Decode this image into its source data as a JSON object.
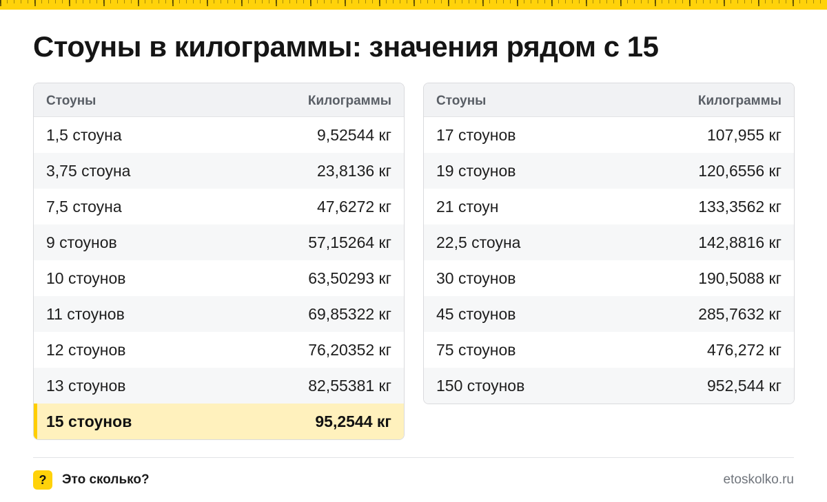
{
  "title": "Стоуны в килограммы: значения рядом с 15",
  "colors": {
    "accent": "#ffd20a",
    "highlight_row": "#fff1bd",
    "header_bg": "#f1f2f4"
  },
  "tables": [
    {
      "headers": [
        "Стоуны",
        "Килограммы"
      ],
      "rows": [
        [
          "1,5 стоуна",
          "9,52544 кг"
        ],
        [
          "3,75 стоуна",
          "23,8136 кг"
        ],
        [
          "7,5 стоуна",
          "47,6272 кг"
        ],
        [
          "9 стоунов",
          "57,15264 кг"
        ],
        [
          "10 стоунов",
          "63,50293 кг"
        ],
        [
          "11 стоунов",
          "69,85322 кг"
        ],
        [
          "12 стоунов",
          "76,20352 кг"
        ],
        [
          "13 стоунов",
          "82,55381 кг"
        ],
        [
          "15 стоунов",
          "95,2544 кг"
        ]
      ],
      "highlighted_row": 8
    },
    {
      "headers": [
        "Стоуны",
        "Килограммы"
      ],
      "rows": [
        [
          "17 стоунов",
          "107,955 кг"
        ],
        [
          "19 стоунов",
          "120,6556 кг"
        ],
        [
          "21 стоун",
          "133,3562 кг"
        ],
        [
          "22,5 стоуна",
          "142,8816 кг"
        ],
        [
          "30 стоунов",
          "190,5088 кг"
        ],
        [
          "45 стоунов",
          "285,7632 кг"
        ],
        [
          "75 стоунов",
          "476,272 кг"
        ],
        [
          "150 стоунов",
          "952,544 кг"
        ]
      ]
    }
  ],
  "footer": {
    "icon": "question-mark-icon",
    "icon_glyph": "?",
    "brand": "Это сколько?",
    "site": "etoskolko.ru"
  }
}
